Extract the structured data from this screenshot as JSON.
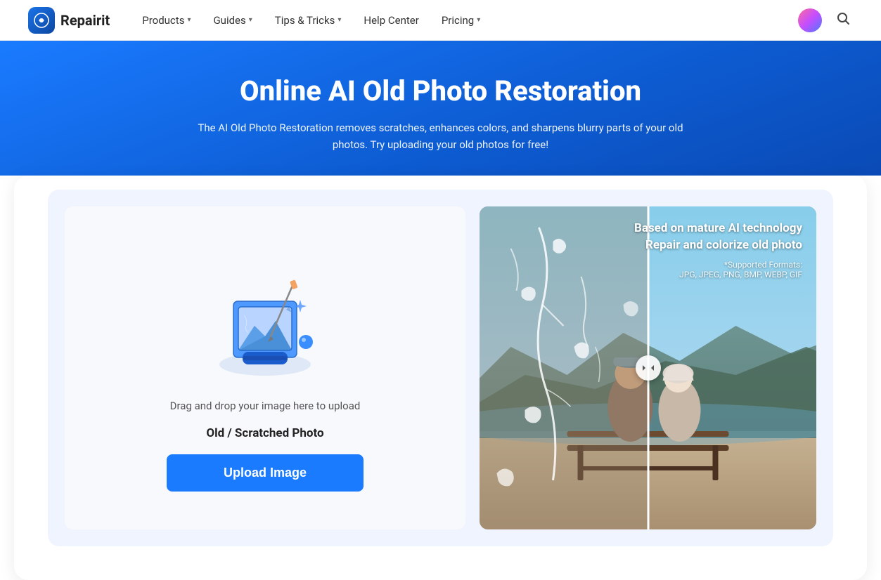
{
  "navbar": {
    "logo_text": "Repairit",
    "nav_items": [
      {
        "label": "Products",
        "has_dropdown": true
      },
      {
        "label": "Guides",
        "has_dropdown": true
      },
      {
        "label": "Tips & Tricks",
        "has_dropdown": true
      },
      {
        "label": "Help Center",
        "has_dropdown": false
      },
      {
        "label": "Pricing",
        "has_dropdown": true
      }
    ]
  },
  "hero": {
    "title": "Online AI Old Photo Restoration",
    "subtitle": "The AI Old Photo Restoration removes scratches, enhances colors, and sharpens blurry parts of your old photos. Try uploading your old photos for free!"
  },
  "upload_panel": {
    "drag_text": "Drag and drop your image here to upload",
    "label": "Old / Scratched Photo",
    "button_label": "Upload Image"
  },
  "preview_panel": {
    "info_title_line1": "Based on mature AI technology",
    "info_title_line2": "Repair and colorize old photo",
    "formats_label": "*Supported Formats:",
    "formats_list": "JPG, JPEG, PNG, BMP, WEBP, GIF"
  },
  "icons": {
    "search": "🔍",
    "chevron_down": "▾",
    "arrows_lr": "◀▶"
  }
}
